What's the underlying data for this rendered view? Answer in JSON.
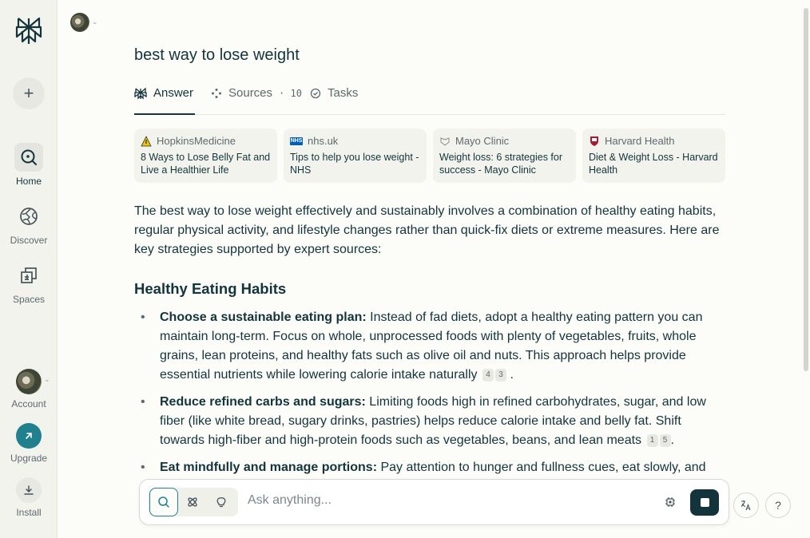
{
  "sidebar": {
    "new_thread_label": "+",
    "items": [
      {
        "label": "Home",
        "icon": "home-search-icon"
      },
      {
        "label": "Discover",
        "icon": "globe-icon"
      },
      {
        "label": "Spaces",
        "icon": "spaces-icon"
      }
    ],
    "account": {
      "label": "Account"
    },
    "upgrade": {
      "label": "Upgrade"
    },
    "install": {
      "label": "Install"
    }
  },
  "thread": {
    "query": "best way to lose weight",
    "tabs": [
      {
        "label": "Answer",
        "icon": "perplexity-icon"
      },
      {
        "label": "Sources",
        "count": "· 10",
        "icon": "sources-icon"
      },
      {
        "label": "Tasks",
        "icon": "tasks-icon"
      }
    ],
    "sources": [
      {
        "site": "HopkinsMedicine",
        "title": "8 Ways to Lose Belly Fat and Live a Healthier Life",
        "favicon_color": "#f2c200"
      },
      {
        "site": "nhs.uk",
        "title": "Tips to help you lose weight - NHS",
        "favicon_color": "#005eb8",
        "favicon_text": "NHS"
      },
      {
        "site": "Mayo Clinic",
        "title": "Weight loss: 6 strategies for success - Mayo Clinic",
        "favicon_color": "#cfcfcf"
      },
      {
        "site": "Harvard Health",
        "title": "Diet & Weight Loss - Harvard Health",
        "favicon_color": "#a51c30"
      }
    ]
  },
  "answer": {
    "intro": "The best way to lose weight effectively and sustainably involves a combination of healthy eating habits, regular physical activity, and lifestyle changes rather than quick-fix diets or extreme measures. Here are key strategies supported by expert sources:",
    "heading": "Healthy Eating Habits",
    "bullets": [
      {
        "bold": "Choose a sustainable eating plan:",
        "text": " Instead of fad diets, adopt a healthy eating pattern you can maintain long-term. Focus on whole, unprocessed foods with plenty of vegetables, fruits, whole grains, lean proteins, and healthy fats such as olive oil and nuts. This approach helps provide essential nutrients while lowering calorie intake naturally",
        "cites": [
          "4",
          "3"
        ],
        "end": "."
      },
      {
        "bold": "Reduce refined carbs and sugars:",
        "text": " Limiting foods high in refined carbohydrates, sugar, and low fiber (like white bread, sugary drinks, pastries) helps reduce calorie intake and belly fat. Shift towards high-fiber and high-protein foods such as vegetables, beans, and lean meats",
        "cites": [
          "1",
          "5"
        ],
        "end": "."
      },
      {
        "bold": "Eat mindfully and manage portions:",
        "text": " Pay attention to hunger and fullness cues, eat slowly, and"
      }
    ]
  },
  "askbar": {
    "placeholder": "Ask anything..."
  },
  "colors": {
    "accent": "#20808d",
    "text": "#13343b",
    "sidebar_bg": "#f3f3ee",
    "page_bg": "#fcfcf9"
  }
}
